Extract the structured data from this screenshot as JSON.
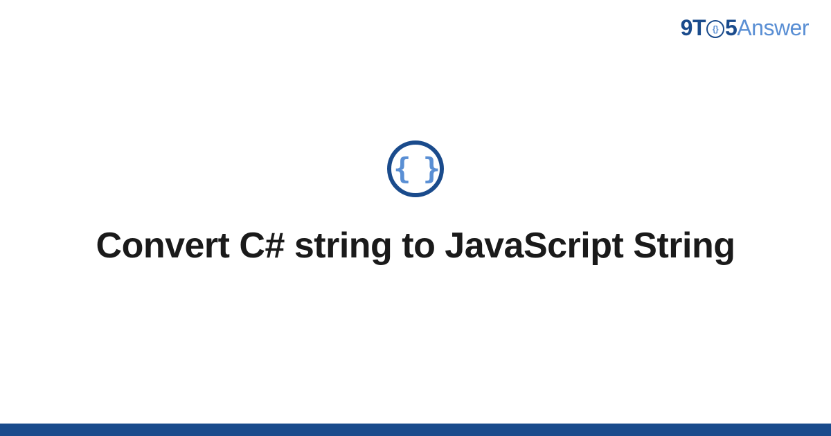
{
  "logo": {
    "part1": "9T",
    "circle_inner": "{}",
    "part2": "5",
    "part3": "Answer"
  },
  "icon": {
    "braces": "{ }"
  },
  "title": "Convert C# string to JavaScript String",
  "colors": {
    "primary": "#1a4b8c",
    "accent": "#5a8fd4"
  }
}
